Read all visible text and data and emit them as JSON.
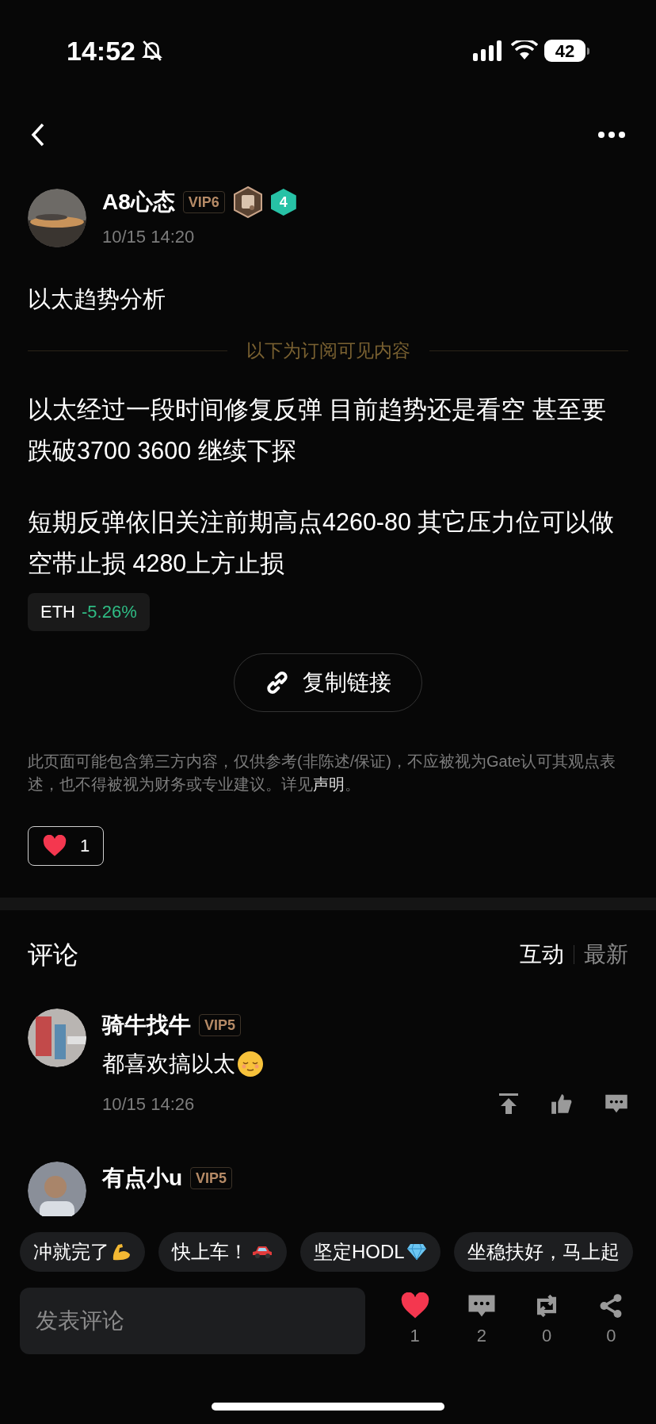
{
  "status_bar": {
    "time": "14:52",
    "battery": "42"
  },
  "post": {
    "author": "A8心态",
    "vip": "VIP6",
    "level": "4",
    "time": "10/15 14:20",
    "title": "以太趋势分析",
    "divider_label": "以下为订阅可见内容",
    "paragraphs": [
      "以太经过一段时间修复反弹 目前趋势还是看空 甚至要跌破3700 3600 继续下探",
      "短期反弹依旧关注前期高点4260-80 其它压力位可以做空带止损 4280上方止损"
    ],
    "ticker": {
      "symbol": "ETH",
      "change": "-5.26%",
      "kind": "loss"
    },
    "copy_link": "复制链接",
    "disclaimer": "此页面可能包含第三方内容，仅供参考(非陈述/保证)，不应被视为Gate认可其观点表述，也不得被视为财务或专业建议。详见",
    "disclaimer_link": "声明",
    "disclaimer_end": "。",
    "like": {
      "count": "1",
      "liked": true
    }
  },
  "comments_section": {
    "title": "评论",
    "sort_tabs": [
      {
        "label": "互动",
        "selected": true
      },
      {
        "label": "最新",
        "selected": false
      }
    ],
    "comments": [
      {
        "author": "骑牛找牛",
        "vip": "VIP5",
        "text": "都喜欢搞以太",
        "kind": "face",
        "time": "10/15 14:26"
      },
      {
        "author": "有点小u",
        "vip": "VIP5"
      }
    ]
  },
  "quick_replies": [
    {
      "text": "冲就完了",
      "kind": "arm"
    },
    {
      "text": "快上车！",
      "kind": "car"
    },
    {
      "text": "坚定HODL",
      "kind": "gem"
    },
    {
      "text": "坐稳扶好，马上起",
      "kind": "plain"
    }
  ],
  "composer": {
    "placeholder": "发表评论"
  },
  "actions": [
    {
      "kind": "like",
      "count": "1",
      "on": true
    },
    {
      "kind": "comment",
      "count": "2"
    },
    {
      "kind": "repost",
      "count": "0"
    },
    {
      "kind": "share",
      "count": "0"
    }
  ]
}
